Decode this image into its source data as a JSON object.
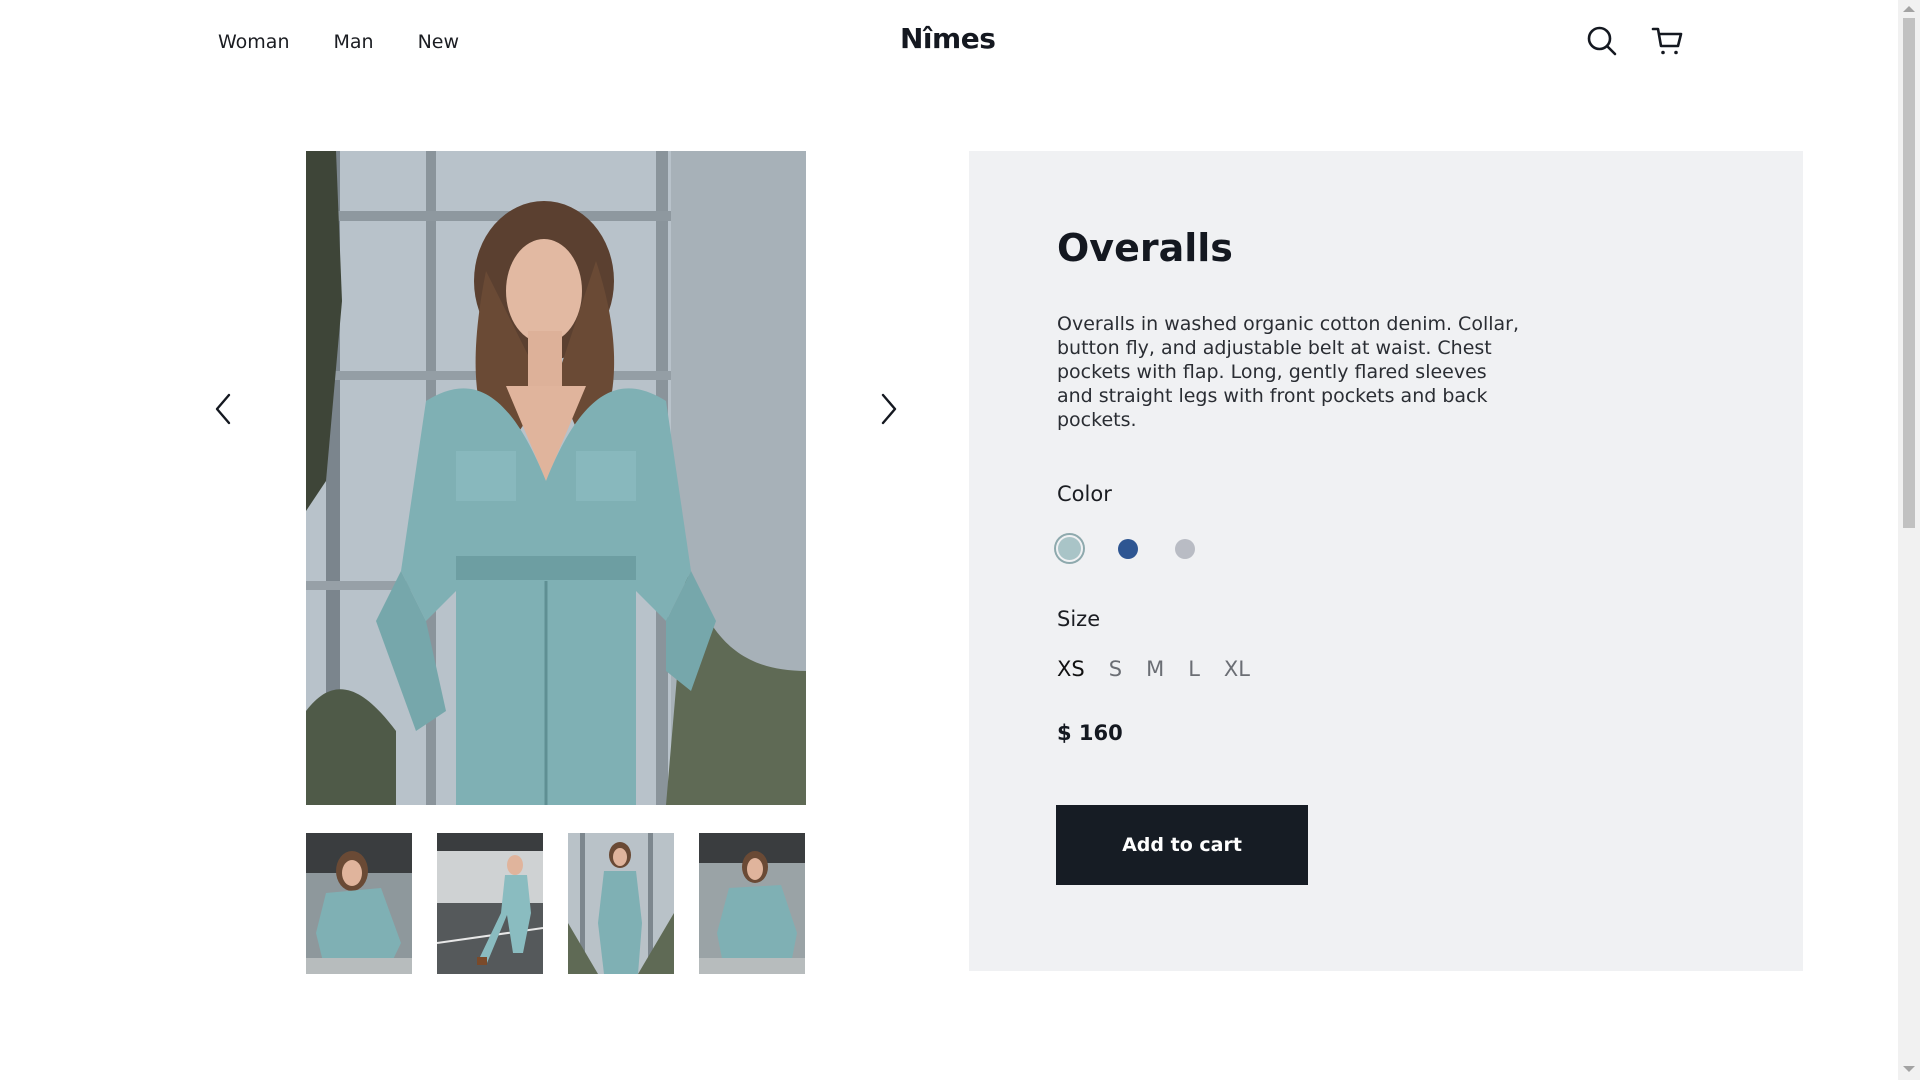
{
  "header": {
    "nav": [
      "Woman",
      "Man",
      "New"
    ],
    "logo": "Nîmes",
    "icons": [
      "search-icon",
      "cart-icon"
    ]
  },
  "gallery": {
    "main_image": "model-in-denim-overalls",
    "thumbnails": [
      "thumbnail-1",
      "thumbnail-2",
      "thumbnail-3",
      "thumbnail-4"
    ],
    "prev_icon": "chevron-left-icon",
    "next_icon": "chevron-right-icon"
  },
  "product": {
    "title": "Overalls",
    "description": "Overalls in washed organic cotton denim. Collar, button fly, and adjustable belt at waist. Chest pockets with flap. Long, gently flared sleeves and straight legs with front pockets and back pockets.",
    "color_label": "Color",
    "colors": [
      "#a9c4c7",
      "#2e5692",
      "#b9bcc4"
    ],
    "selected_color_index": 0,
    "size_label": "Size",
    "sizes": [
      "XS",
      "S",
      "M",
      "L",
      "XL"
    ],
    "selected_size": "XS",
    "price": "$ 160",
    "add_to_cart": "Add to cart"
  },
  "colors": {
    "panel_bg": "#f0f1f3",
    "button_bg": "#161c24",
    "text": "#141820"
  }
}
